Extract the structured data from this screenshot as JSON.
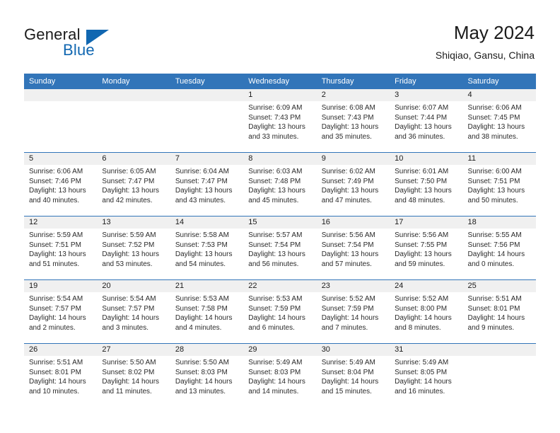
{
  "brand": {
    "name_part1": "General",
    "name_part2": "Blue"
  },
  "header": {
    "title": "May 2024",
    "subtitle": "Shiqiao, Gansu, China"
  },
  "weekdays": [
    "Sunday",
    "Monday",
    "Tuesday",
    "Wednesday",
    "Thursday",
    "Friday",
    "Saturday"
  ],
  "labels": {
    "sunrise_prefix": "Sunrise: ",
    "sunset_prefix": "Sunset: ",
    "daylight_prefix": "Daylight: "
  },
  "weeks": [
    [
      {
        "empty": true
      },
      {
        "empty": true
      },
      {
        "empty": true
      },
      {
        "day": "1",
        "sunrise": "Sunrise: 6:09 AM",
        "sunset": "Sunset: 7:43 PM",
        "daylight_line1": "Daylight: 13 hours",
        "daylight_line2": "and 33 minutes."
      },
      {
        "day": "2",
        "sunrise": "Sunrise: 6:08 AM",
        "sunset": "Sunset: 7:43 PM",
        "daylight_line1": "Daylight: 13 hours",
        "daylight_line2": "and 35 minutes."
      },
      {
        "day": "3",
        "sunrise": "Sunrise: 6:07 AM",
        "sunset": "Sunset: 7:44 PM",
        "daylight_line1": "Daylight: 13 hours",
        "daylight_line2": "and 36 minutes."
      },
      {
        "day": "4",
        "sunrise": "Sunrise: 6:06 AM",
        "sunset": "Sunset: 7:45 PM",
        "daylight_line1": "Daylight: 13 hours",
        "daylight_line2": "and 38 minutes."
      }
    ],
    [
      {
        "day": "5",
        "sunrise": "Sunrise: 6:06 AM",
        "sunset": "Sunset: 7:46 PM",
        "daylight_line1": "Daylight: 13 hours",
        "daylight_line2": "and 40 minutes."
      },
      {
        "day": "6",
        "sunrise": "Sunrise: 6:05 AM",
        "sunset": "Sunset: 7:47 PM",
        "daylight_line1": "Daylight: 13 hours",
        "daylight_line2": "and 42 minutes."
      },
      {
        "day": "7",
        "sunrise": "Sunrise: 6:04 AM",
        "sunset": "Sunset: 7:47 PM",
        "daylight_line1": "Daylight: 13 hours",
        "daylight_line2": "and 43 minutes."
      },
      {
        "day": "8",
        "sunrise": "Sunrise: 6:03 AM",
        "sunset": "Sunset: 7:48 PM",
        "daylight_line1": "Daylight: 13 hours",
        "daylight_line2": "and 45 minutes."
      },
      {
        "day": "9",
        "sunrise": "Sunrise: 6:02 AM",
        "sunset": "Sunset: 7:49 PM",
        "daylight_line1": "Daylight: 13 hours",
        "daylight_line2": "and 47 minutes."
      },
      {
        "day": "10",
        "sunrise": "Sunrise: 6:01 AM",
        "sunset": "Sunset: 7:50 PM",
        "daylight_line1": "Daylight: 13 hours",
        "daylight_line2": "and 48 minutes."
      },
      {
        "day": "11",
        "sunrise": "Sunrise: 6:00 AM",
        "sunset": "Sunset: 7:51 PM",
        "daylight_line1": "Daylight: 13 hours",
        "daylight_line2": "and 50 minutes."
      }
    ],
    [
      {
        "day": "12",
        "sunrise": "Sunrise: 5:59 AM",
        "sunset": "Sunset: 7:51 PM",
        "daylight_line1": "Daylight: 13 hours",
        "daylight_line2": "and 51 minutes."
      },
      {
        "day": "13",
        "sunrise": "Sunrise: 5:59 AM",
        "sunset": "Sunset: 7:52 PM",
        "daylight_line1": "Daylight: 13 hours",
        "daylight_line2": "and 53 minutes."
      },
      {
        "day": "14",
        "sunrise": "Sunrise: 5:58 AM",
        "sunset": "Sunset: 7:53 PM",
        "daylight_line1": "Daylight: 13 hours",
        "daylight_line2": "and 54 minutes."
      },
      {
        "day": "15",
        "sunrise": "Sunrise: 5:57 AM",
        "sunset": "Sunset: 7:54 PM",
        "daylight_line1": "Daylight: 13 hours",
        "daylight_line2": "and 56 minutes."
      },
      {
        "day": "16",
        "sunrise": "Sunrise: 5:56 AM",
        "sunset": "Sunset: 7:54 PM",
        "daylight_line1": "Daylight: 13 hours",
        "daylight_line2": "and 57 minutes."
      },
      {
        "day": "17",
        "sunrise": "Sunrise: 5:56 AM",
        "sunset": "Sunset: 7:55 PM",
        "daylight_line1": "Daylight: 13 hours",
        "daylight_line2": "and 59 minutes."
      },
      {
        "day": "18",
        "sunrise": "Sunrise: 5:55 AM",
        "sunset": "Sunset: 7:56 PM",
        "daylight_line1": "Daylight: 14 hours",
        "daylight_line2": "and 0 minutes."
      }
    ],
    [
      {
        "day": "19",
        "sunrise": "Sunrise: 5:54 AM",
        "sunset": "Sunset: 7:57 PM",
        "daylight_line1": "Daylight: 14 hours",
        "daylight_line2": "and 2 minutes."
      },
      {
        "day": "20",
        "sunrise": "Sunrise: 5:54 AM",
        "sunset": "Sunset: 7:57 PM",
        "daylight_line1": "Daylight: 14 hours",
        "daylight_line2": "and 3 minutes."
      },
      {
        "day": "21",
        "sunrise": "Sunrise: 5:53 AM",
        "sunset": "Sunset: 7:58 PM",
        "daylight_line1": "Daylight: 14 hours",
        "daylight_line2": "and 4 minutes."
      },
      {
        "day": "22",
        "sunrise": "Sunrise: 5:53 AM",
        "sunset": "Sunset: 7:59 PM",
        "daylight_line1": "Daylight: 14 hours",
        "daylight_line2": "and 6 minutes."
      },
      {
        "day": "23",
        "sunrise": "Sunrise: 5:52 AM",
        "sunset": "Sunset: 7:59 PM",
        "daylight_line1": "Daylight: 14 hours",
        "daylight_line2": "and 7 minutes."
      },
      {
        "day": "24",
        "sunrise": "Sunrise: 5:52 AM",
        "sunset": "Sunset: 8:00 PM",
        "daylight_line1": "Daylight: 14 hours",
        "daylight_line2": "and 8 minutes."
      },
      {
        "day": "25",
        "sunrise": "Sunrise: 5:51 AM",
        "sunset": "Sunset: 8:01 PM",
        "daylight_line1": "Daylight: 14 hours",
        "daylight_line2": "and 9 minutes."
      }
    ],
    [
      {
        "day": "26",
        "sunrise": "Sunrise: 5:51 AM",
        "sunset": "Sunset: 8:01 PM",
        "daylight_line1": "Daylight: 14 hours",
        "daylight_line2": "and 10 minutes."
      },
      {
        "day": "27",
        "sunrise": "Sunrise: 5:50 AM",
        "sunset": "Sunset: 8:02 PM",
        "daylight_line1": "Daylight: 14 hours",
        "daylight_line2": "and 11 minutes."
      },
      {
        "day": "28",
        "sunrise": "Sunrise: 5:50 AM",
        "sunset": "Sunset: 8:03 PM",
        "daylight_line1": "Daylight: 14 hours",
        "daylight_line2": "and 13 minutes."
      },
      {
        "day": "29",
        "sunrise": "Sunrise: 5:49 AM",
        "sunset": "Sunset: 8:03 PM",
        "daylight_line1": "Daylight: 14 hours",
        "daylight_line2": "and 14 minutes."
      },
      {
        "day": "30",
        "sunrise": "Sunrise: 5:49 AM",
        "sunset": "Sunset: 8:04 PM",
        "daylight_line1": "Daylight: 14 hours",
        "daylight_line2": "and 15 minutes."
      },
      {
        "day": "31",
        "sunrise": "Sunrise: 5:49 AM",
        "sunset": "Sunset: 8:05 PM",
        "daylight_line1": "Daylight: 14 hours",
        "daylight_line2": "and 16 minutes."
      },
      {
        "empty": true
      }
    ]
  ],
  "colors": {
    "header_blue": "#3275b9",
    "brand_blue": "#1167b1",
    "day_strip_gray": "#f0f0f0"
  }
}
